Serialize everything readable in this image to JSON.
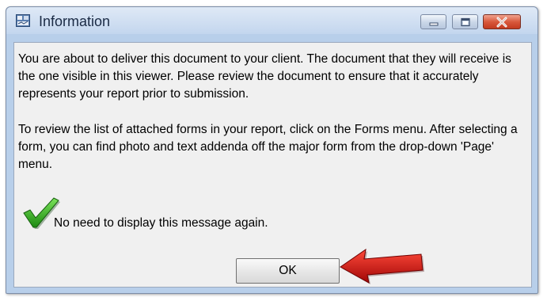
{
  "window": {
    "title": "Information",
    "icon": "app-icon"
  },
  "controls": {
    "minimize_icon": "minimize-icon",
    "maximize_icon": "maximize-icon",
    "close_icon": "close-icon"
  },
  "message": {
    "paragraph1": "You are about to deliver this document to your client. The document that they will receive is the one visible in this viewer.  Please review the document to ensure that it accurately represents your report prior to submission.",
    "paragraph2": "To review the list of attached forms in your report, click on the Forms menu. After selecting a form, you can find photo and text addenda off the major form from the drop-down 'Page' menu."
  },
  "dont_show": {
    "label": "No need to display this message again.",
    "checked": true,
    "check_icon": "green-checkmark-icon"
  },
  "ok_button": {
    "label": "OK"
  },
  "annotation": {
    "icon": "red-arrow-icon"
  },
  "colors": {
    "title_bar": "#c9dcf1",
    "client_bg": "#f0f0f0",
    "close_button": "#d9593c",
    "check": "#2e9e1e",
    "arrow": "#d01010"
  }
}
